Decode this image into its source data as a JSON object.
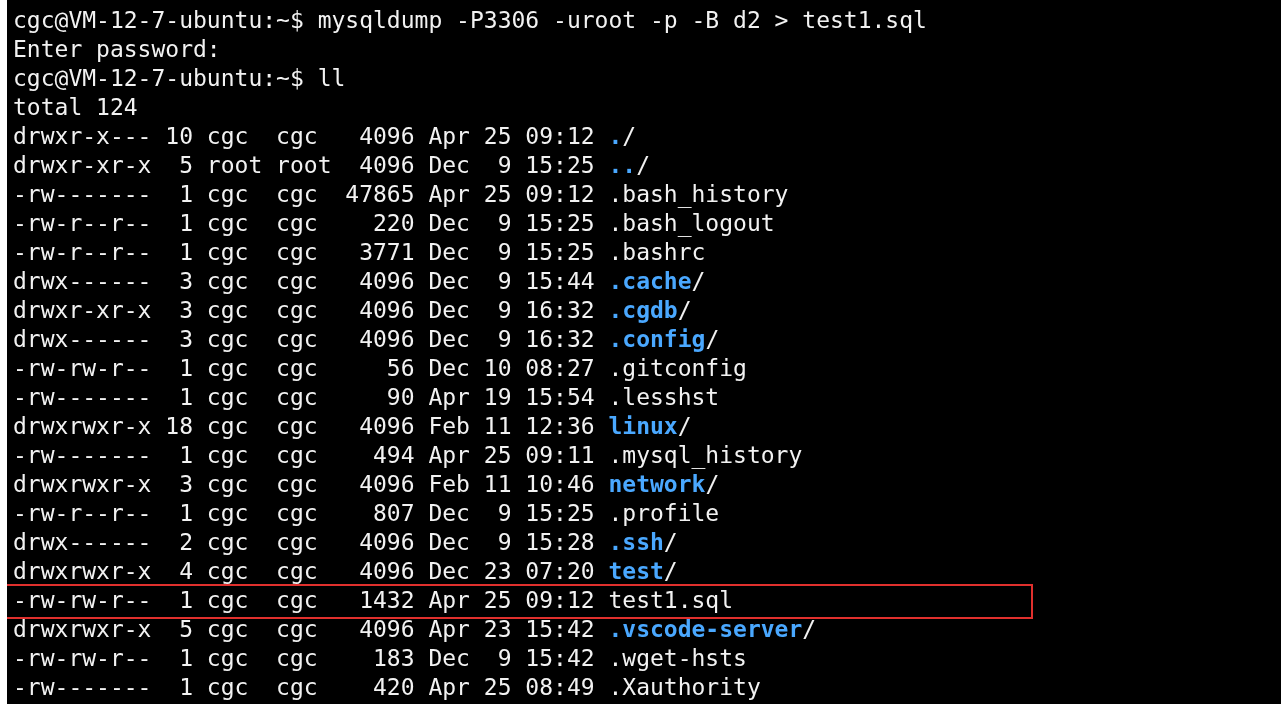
{
  "terminal": {
    "lines": [
      {
        "kind": "text",
        "text": "cgc@VM-12-7-ubuntu:~$ mysqldump -P3306 -uroot -p -B d2 > test1.sql"
      },
      {
        "kind": "text",
        "text": "Enter password:"
      },
      {
        "kind": "text",
        "text": "cgc@VM-12-7-ubuntu:~$ ll"
      },
      {
        "kind": "text",
        "text": "total 124"
      },
      {
        "kind": "entry",
        "meta": "drwxr-x--- 10 cgc  cgc   4096 Apr 25 09:12",
        "name": ".",
        "is_dir": true,
        "highlighted": false
      },
      {
        "kind": "entry",
        "meta": "drwxr-xr-x  5 root root  4096 Dec  9 15:25",
        "name": "..",
        "is_dir": true,
        "highlighted": false
      },
      {
        "kind": "entry",
        "meta": "-rw-------  1 cgc  cgc  47865 Apr 25 09:12",
        "name": ".bash_history",
        "is_dir": false,
        "highlighted": false
      },
      {
        "kind": "entry",
        "meta": "-rw-r--r--  1 cgc  cgc    220 Dec  9 15:25",
        "name": ".bash_logout",
        "is_dir": false,
        "highlighted": false
      },
      {
        "kind": "entry",
        "meta": "-rw-r--r--  1 cgc  cgc   3771 Dec  9 15:25",
        "name": ".bashrc",
        "is_dir": false,
        "highlighted": false
      },
      {
        "kind": "entry",
        "meta": "drwx------  3 cgc  cgc   4096 Dec  9 15:44",
        "name": ".cache",
        "is_dir": true,
        "highlighted": false
      },
      {
        "kind": "entry",
        "meta": "drwxr-xr-x  3 cgc  cgc   4096 Dec  9 16:32",
        "name": ".cgdb",
        "is_dir": true,
        "highlighted": false
      },
      {
        "kind": "entry",
        "meta": "drwx------  3 cgc  cgc   4096 Dec  9 16:32",
        "name": ".config",
        "is_dir": true,
        "highlighted": false
      },
      {
        "kind": "entry",
        "meta": "-rw-rw-r--  1 cgc  cgc     56 Dec 10 08:27",
        "name": ".gitconfig",
        "is_dir": false,
        "highlighted": false
      },
      {
        "kind": "entry",
        "meta": "-rw-------  1 cgc  cgc     90 Apr 19 15:54",
        "name": ".lesshst",
        "is_dir": false,
        "highlighted": false
      },
      {
        "kind": "entry",
        "meta": "drwxrwxr-x 18 cgc  cgc   4096 Feb 11 12:36",
        "name": "linux",
        "is_dir": true,
        "highlighted": false
      },
      {
        "kind": "entry",
        "meta": "-rw-------  1 cgc  cgc    494 Apr 25 09:11",
        "name": ".mysql_history",
        "is_dir": false,
        "highlighted": false
      },
      {
        "kind": "entry",
        "meta": "drwxrwxr-x  3 cgc  cgc   4096 Feb 11 10:46",
        "name": "network",
        "is_dir": true,
        "highlighted": false
      },
      {
        "kind": "entry",
        "meta": "-rw-r--r--  1 cgc  cgc    807 Dec  9 15:25",
        "name": ".profile",
        "is_dir": false,
        "highlighted": false
      },
      {
        "kind": "entry",
        "meta": "drwx------  2 cgc  cgc   4096 Dec  9 15:28",
        "name": ".ssh",
        "is_dir": true,
        "highlighted": false
      },
      {
        "kind": "entry",
        "meta": "drwxrwxr-x  4 cgc  cgc   4096 Dec 23 07:20",
        "name": "test",
        "is_dir": true,
        "highlighted": false
      },
      {
        "kind": "entry",
        "meta": "-rw-rw-r--  1 cgc  cgc   1432 Apr 25 09:12",
        "name": "test1.sql",
        "is_dir": false,
        "highlighted": true
      },
      {
        "kind": "entry",
        "meta": "drwxrwxr-x  5 cgc  cgc   4096 Apr 23 15:42",
        "name": ".vscode-server",
        "is_dir": true,
        "highlighted": false
      },
      {
        "kind": "entry",
        "meta": "-rw-rw-r--  1 cgc  cgc    183 Dec  9 15:42",
        "name": ".wget-hsts",
        "is_dir": false,
        "highlighted": false
      },
      {
        "kind": "entry",
        "meta": "-rw-------  1 cgc  cgc    420 Apr 25 08:49",
        "name": ".Xauthority",
        "is_dir": false,
        "highlighted": false
      }
    ]
  },
  "dir_suffix": "/"
}
